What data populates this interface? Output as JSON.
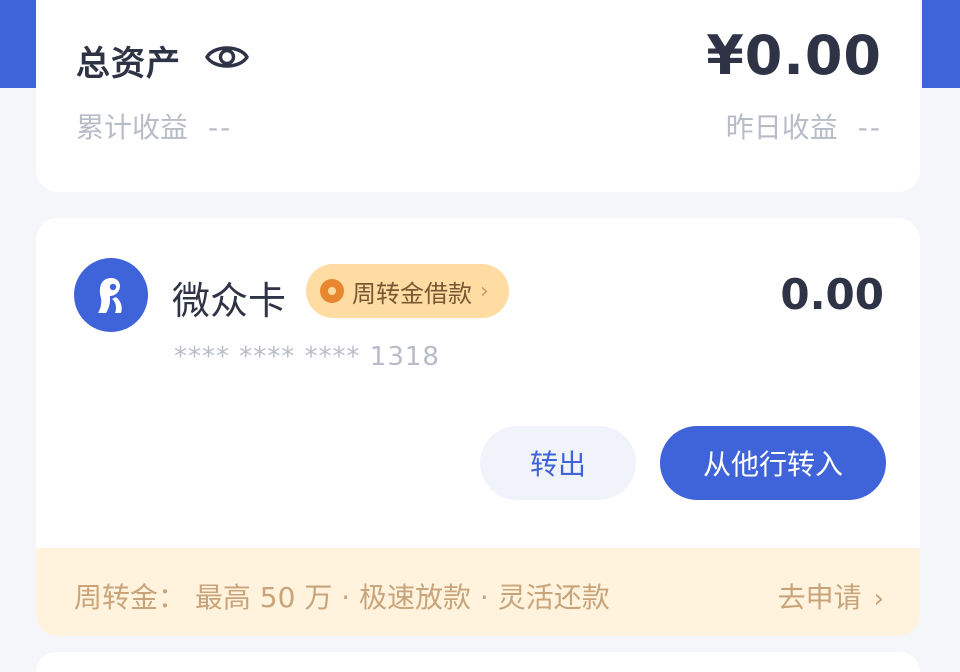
{
  "assets": {
    "title": "总资产",
    "total": "¥0.00",
    "cumulative_label": "累计收益",
    "cumulative_value": "--",
    "yesterday_label": "昨日收益",
    "yesterday_value": "--"
  },
  "account": {
    "name": "微众卡",
    "badge_label": "周转金借款",
    "badge_chevron": "›",
    "balance": "0.00",
    "number": "**** **** **** 1318",
    "transfer_out_label": "转出",
    "transfer_in_label": "从他行转入"
  },
  "promo": {
    "text": "周转金：  最高 50 万 · 极速放款 · 灵活还款",
    "link_label": "去申请",
    "link_chevron": "›"
  },
  "colors": {
    "brand_blue": "#3f63d8",
    "badge_bg": "#ffdca2",
    "promo_bg": "#fff3dd"
  },
  "icons": {
    "eye": "eye-icon",
    "logo": "bank-logo-icon",
    "coin": "coin-icon",
    "chevron": "chevron-right-icon"
  }
}
